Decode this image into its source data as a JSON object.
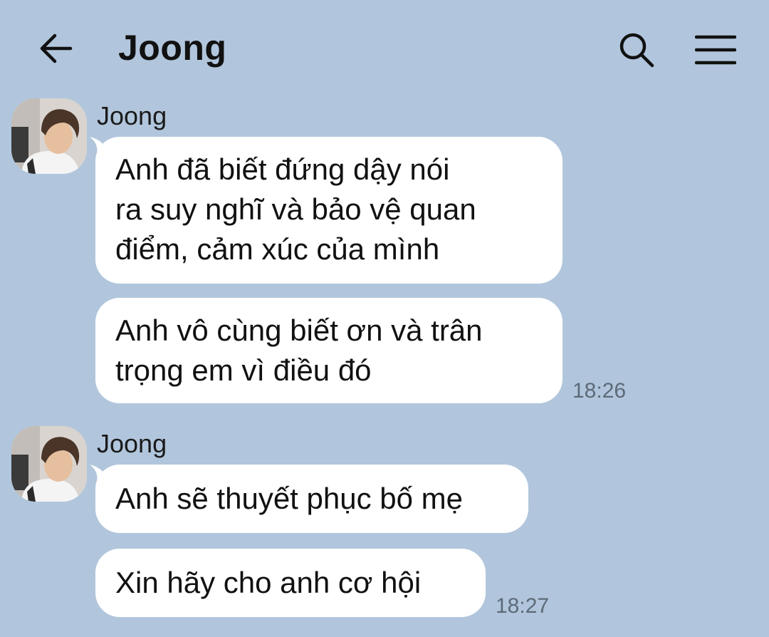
{
  "header": {
    "title": "Joong",
    "back_icon": "arrow-left-icon",
    "search_icon": "search-icon",
    "menu_icon": "menu-icon"
  },
  "colors": {
    "background": "#b1c6dc",
    "bubble": "#ffffff",
    "text": "#111111",
    "time": "#5d6a78"
  },
  "groups": [
    {
      "sender": "Joong",
      "messages": [
        {
          "text": "Anh đã biết đứng dậy nói\nra suy nghĩ và bảo vệ quan\nđiểm, cảm xúc của mình"
        },
        {
          "text": "Anh vô cùng biết ơn và trân\ntrọng em vì điều đó"
        }
      ],
      "time": "18:26"
    },
    {
      "sender": "Joong",
      "messages": [
        {
          "text": "Anh sẽ thuyết phục bố mẹ"
        },
        {
          "text": "Xin hãy cho anh cơ hội"
        }
      ],
      "time": "18:27"
    }
  ]
}
